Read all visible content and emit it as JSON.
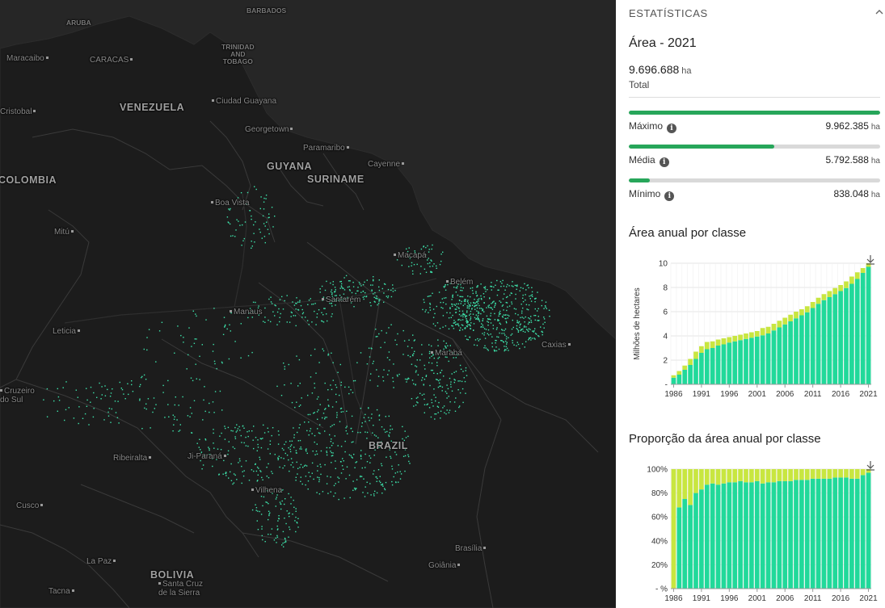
{
  "map": {
    "countries": [
      {
        "name": "VENEZUELA",
        "x": 148,
        "y": 126
      },
      {
        "name": "GUYANA",
        "x": 330,
        "y": 199
      },
      {
        "name": "SURINAME",
        "x": 380,
        "y": 215
      },
      {
        "name": "COLOMBIA",
        "x": -2,
        "y": 216
      },
      {
        "name": "BRAZIL",
        "x": 456,
        "y": 545
      },
      {
        "name": "BOLIVIA",
        "x": 186,
        "y": 705
      }
    ],
    "small_labels": [
      {
        "name": "ARUBA",
        "x": 82,
        "y": 24
      },
      {
        "name": "BARBADOS",
        "x": 305,
        "y": 9
      },
      {
        "name": "TRINIDAD\nAND\nTOBAGO",
        "x": 274,
        "y": 54
      }
    ],
    "cities": [
      {
        "name": "Maracaibo",
        "x": 8,
        "y": 67,
        "after": true
      },
      {
        "name": "CARACAS",
        "x": 111,
        "y": 69,
        "after": true,
        "caps": true
      },
      {
        "name": "Cristobal",
        "x": 0,
        "y": 133,
        "after": true
      },
      {
        "name": "Ciudad Guayana",
        "x": 262,
        "y": 120
      },
      {
        "name": "Georgetown",
        "x": 303,
        "y": 155,
        "after": true
      },
      {
        "name": "Paramaribo",
        "x": 375,
        "y": 178,
        "after": true
      },
      {
        "name": "Cayenne",
        "x": 455,
        "y": 198,
        "after": true
      },
      {
        "name": "Boa Vista",
        "x": 261,
        "y": 246
      },
      {
        "name": "Mitú",
        "x": 67,
        "y": 282,
        "after": true
      },
      {
        "name": "Macapá",
        "x": 487,
        "y": 311
      },
      {
        "name": "Belém",
        "x": 552,
        "y": 344
      },
      {
        "name": "Manaus",
        "x": 284,
        "y": 381
      },
      {
        "name": "Santarém",
        "x": 398,
        "y": 366
      },
      {
        "name": "Leticia",
        "x": 65,
        "y": 405,
        "after": true
      },
      {
        "name": "Marabá",
        "x": 533,
        "y": 432
      },
      {
        "name": "Caxias",
        "x": 670,
        "y": 422,
        "after": true
      },
      {
        "name": "Cruzeiro\ndo Sul",
        "x": 0,
        "y": 479
      },
      {
        "name": "Ribeiralta",
        "x": 140,
        "y": 562,
        "after": true
      },
      {
        "name": "Ji-Paraná",
        "x": 232,
        "y": 560,
        "after": true
      },
      {
        "name": "Vilhena",
        "x": 311,
        "y": 602
      },
      {
        "name": "Cusco",
        "x": 20,
        "y": 621,
        "after": true
      },
      {
        "name": "La Paz",
        "x": 107,
        "y": 690,
        "after": true
      },
      {
        "name": "Santa Cruz\nde la Sierra",
        "x": 196,
        "y": 718
      },
      {
        "name": "Brasília",
        "x": 563,
        "y": 674,
        "after": true
      },
      {
        "name": "Goiânia",
        "x": 530,
        "y": 695,
        "after": true
      },
      {
        "name": "Tacna",
        "x": 60,
        "y": 727,
        "after": true
      }
    ]
  },
  "panel": {
    "header": "ESTATÍSTICAS",
    "area_title": "Área - 2021",
    "total_value": "9.696.688",
    "total_unit": "ha",
    "total_label": "Total",
    "stats": [
      {
        "label": "Máximo",
        "value": "9.962.385",
        "unit": "ha",
        "fraction": 1.0
      },
      {
        "label": "Média",
        "value": "5.792.588",
        "unit": "ha",
        "fraction": 0.58
      },
      {
        "label": "Mínimo",
        "value": "838.048",
        "unit": "ha",
        "fraction": 0.084
      }
    ],
    "chart1_title": "Área anual por classe",
    "chart2_title": "Proporção da área anual por classe"
  },
  "colors": {
    "green": "#21d99a",
    "lime": "#c8e640",
    "stat_bar": "#27a65a",
    "map_points": "#3ee6ad"
  },
  "chart_data": [
    {
      "type": "bar",
      "stacked": true,
      "title": "Área anual por classe",
      "ylabel": "Milhões de hectares",
      "ylim": [
        0,
        10
      ],
      "yticks": [
        "-",
        "2",
        "4",
        "6",
        "8",
        "10"
      ],
      "xticks": [
        "1986",
        "1991",
        "1996",
        "2001",
        "2006",
        "2011",
        "2016",
        "2021"
      ],
      "x": [
        1986,
        1987,
        1988,
        1989,
        1990,
        1991,
        1992,
        1993,
        1994,
        1995,
        1996,
        1997,
        1998,
        1999,
        2000,
        2001,
        2002,
        2003,
        2004,
        2005,
        2006,
        2007,
        2008,
        2009,
        2010,
        2011,
        2012,
        2013,
        2014,
        2015,
        2016,
        2017,
        2018,
        2019,
        2020,
        2021
      ],
      "series": [
        {
          "values": [
            0.55,
            0.8,
            1.2,
            1.6,
            2.1,
            2.6,
            2.9,
            3.0,
            3.2,
            3.3,
            3.45,
            3.55,
            3.65,
            3.75,
            3.85,
            3.95,
            4.05,
            4.2,
            4.45,
            4.7,
            4.95,
            5.2,
            5.45,
            5.7,
            5.95,
            6.3,
            6.65,
            6.95,
            7.2,
            7.45,
            7.7,
            7.95,
            8.3,
            8.7,
            9.2,
            9.7
          ]
        },
        {
          "values": [
            0.2,
            0.3,
            0.35,
            0.5,
            0.6,
            0.55,
            0.6,
            0.55,
            0.5,
            0.5,
            0.45,
            0.45,
            0.45,
            0.45,
            0.45,
            0.45,
            0.6,
            0.55,
            0.55,
            0.55,
            0.55,
            0.55,
            0.55,
            0.5,
            0.5,
            0.5,
            0.5,
            0.5,
            0.5,
            0.5,
            0.5,
            0.55,
            0.6,
            0.55,
            0.4,
            0.3
          ]
        }
      ]
    },
    {
      "type": "bar",
      "stacked": true,
      "title": "Proporção da área anual por classe",
      "ylim": [
        0,
        100
      ],
      "yticks": [
        "- %",
        "20%",
        "40%",
        "60%",
        "80%",
        "100%"
      ],
      "xticks": [
        "1986",
        "1991",
        "1996",
        "2001",
        "2006",
        "2011",
        "2016",
        "2021"
      ],
      "x": [
        1986,
        1987,
        1988,
        1989,
        1990,
        1991,
        1992,
        1993,
        1994,
        1995,
        1996,
        1997,
        1998,
        1999,
        2000,
        2001,
        2002,
        2003,
        2004,
        2005,
        2006,
        2007,
        2008,
        2009,
        2010,
        2011,
        2012,
        2013,
        2014,
        2015,
        2016,
        2017,
        2018,
        2019,
        2020,
        2021
      ],
      "series": [
        {
          "values": [
            0,
            68,
            75,
            70,
            80,
            83,
            87,
            88,
            87,
            88,
            89,
            89,
            90,
            89,
            89,
            90,
            88,
            89,
            89,
            90,
            90,
            90,
            91,
            91,
            91,
            92,
            92,
            92,
            92,
            93,
            93,
            93,
            92,
            92,
            95,
            97
          ]
        },
        {
          "values": [
            100,
            32,
            25,
            30,
            20,
            17,
            13,
            12,
            13,
            12,
            11,
            11,
            10,
            11,
            11,
            10,
            12,
            11,
            11,
            10,
            10,
            10,
            9,
            9,
            9,
            8,
            8,
            8,
            8,
            7,
            7,
            7,
            8,
            8,
            5,
            3
          ]
        }
      ]
    }
  ]
}
